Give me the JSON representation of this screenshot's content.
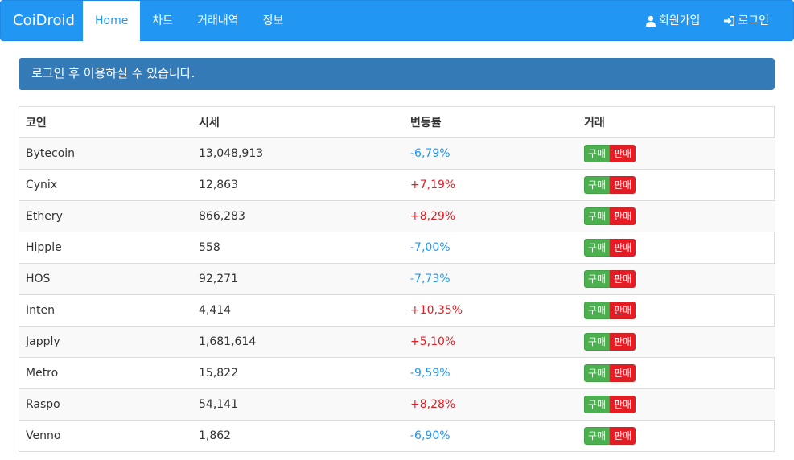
{
  "nav": {
    "brand": "CoiDroid",
    "items": [
      {
        "label": "Home"
      },
      {
        "label": "차트"
      },
      {
        "label": "거래내역"
      },
      {
        "label": "정보"
      }
    ],
    "signup": {
      "label": "회원가입",
      "icon": "user-icon"
    },
    "login": {
      "label": "로그인",
      "icon": "login-icon"
    },
    "colors": {
      "bar": "#2196f3",
      "active_text": "#2196f3"
    }
  },
  "alert": {
    "text": "로그인 후 이용하실 수 있습니다.",
    "color": "#337ab7"
  },
  "table": {
    "headers": [
      "코인",
      "시세",
      "변동률",
      "거래"
    ],
    "buy_label": "구매",
    "sell_label": "판매",
    "rows": [
      {
        "coin": "Bytecoin",
        "price": "13,048,913",
        "change": "-6,79%",
        "direction": "down"
      },
      {
        "coin": "Cynix",
        "price": "12,863",
        "change": "+7,19%",
        "direction": "up"
      },
      {
        "coin": "Ethery",
        "price": "866,283",
        "change": "+8,29%",
        "direction": "up"
      },
      {
        "coin": "Hipple",
        "price": "558",
        "change": "-7,00%",
        "direction": "down"
      },
      {
        "coin": "HOS",
        "price": "92,271",
        "change": "-7,73%",
        "direction": "down"
      },
      {
        "coin": "Inten",
        "price": "4,414",
        "change": "+10,35%",
        "direction": "up"
      },
      {
        "coin": "Japply",
        "price": "1,681,614",
        "change": "+5,10%",
        "direction": "up"
      },
      {
        "coin": "Metro",
        "price": "15,822",
        "change": "-9,59%",
        "direction": "down"
      },
      {
        "coin": "Raspo",
        "price": "54,141",
        "change": "+8,28%",
        "direction": "up"
      },
      {
        "coin": "Venno",
        "price": "1,862",
        "change": "-6,90%",
        "direction": "down"
      }
    ],
    "colors": {
      "up": "#e51c23",
      "down": "#2196f3",
      "buy": "#4caf50",
      "sell": "#e51c23"
    }
  }
}
